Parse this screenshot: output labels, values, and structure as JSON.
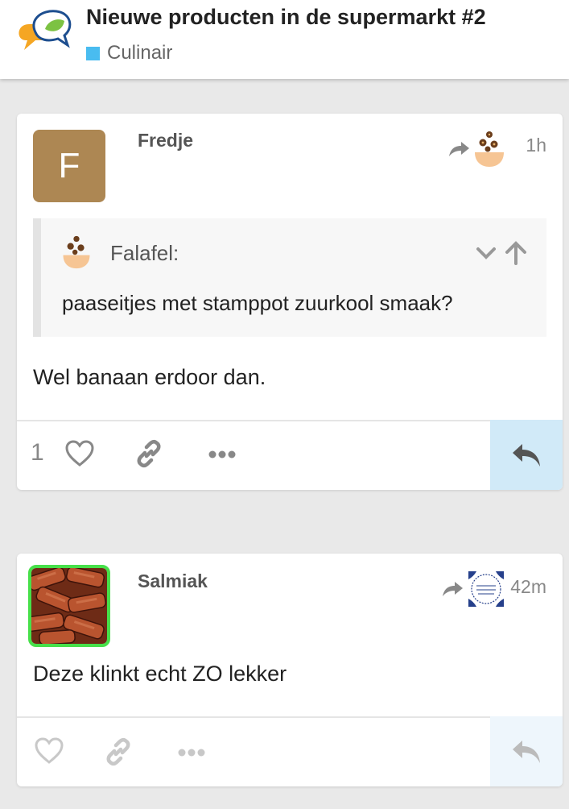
{
  "header": {
    "title": "Nieuwe producten in de supermarkt #2",
    "category": {
      "name": "Culinair",
      "color": "#49bcf0"
    },
    "logo_icon": "speech-bubbles-logo"
  },
  "posts": [
    {
      "username": "Fredje",
      "avatar_letter": "F",
      "avatar_color": "#ad8753",
      "reply_to_avatar": "falafel-bowl-avatar",
      "time": "1h",
      "quote": {
        "author": "Falafel:",
        "text": "paaseitjes met stamppot zuurkool smaak?"
      },
      "body": "Wel banaan erdoor dan.",
      "like_count": "1",
      "reply_button_bg": "#d1eaf8",
      "action_color": "#888888"
    },
    {
      "username": "Salmiak",
      "avatar_image": "salmiak-candy",
      "avatar_border_color": "#47e04a",
      "reply_to_avatar": "delft-tile-avatar",
      "time": "42m",
      "body": "Deze klinkt echt ZO lekker",
      "reply_button_bg": "#eef6fc",
      "action_color": "#c8c8c8"
    }
  ]
}
